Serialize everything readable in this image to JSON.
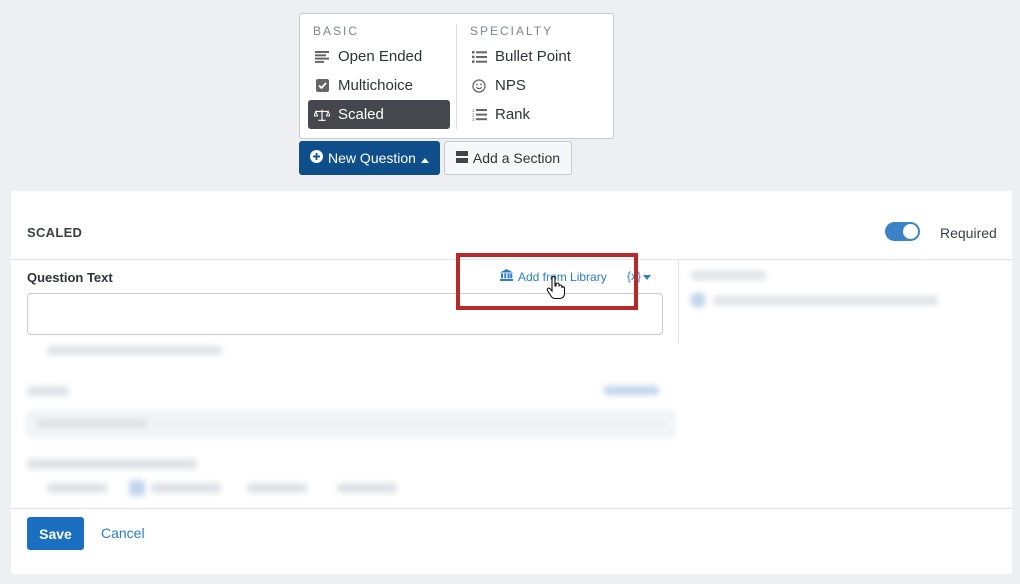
{
  "type_menu": {
    "basic_heading": "BASIC",
    "specialty_heading": "SPECIALTY",
    "basic_items": [
      {
        "label": "Open Ended",
        "icon": "lines-icon"
      },
      {
        "label": "Multichoice",
        "icon": "checkbox-icon"
      },
      {
        "label": "Scaled",
        "icon": "scale-icon",
        "active": true
      }
    ],
    "specialty_items": [
      {
        "label": "Bullet Point",
        "icon": "bullet-list-icon"
      },
      {
        "label": "NPS",
        "icon": "smiley-icon"
      },
      {
        "label": "Rank",
        "icon": "ranked-list-icon"
      }
    ]
  },
  "actions": {
    "new_question": "New Question",
    "add_section": "Add a Section"
  },
  "panel": {
    "title": "SCALED",
    "required_label": "Required",
    "required_on": true,
    "question_label": "Question Text",
    "library_link": "Add from Library",
    "vars_label": "{x}",
    "question_value": ""
  },
  "footer": {
    "save": "Save",
    "cancel": "Cancel"
  },
  "colors": {
    "primary": "#0e4e8a",
    "link": "#2f7dc4",
    "highlight": "#b52a2a"
  }
}
